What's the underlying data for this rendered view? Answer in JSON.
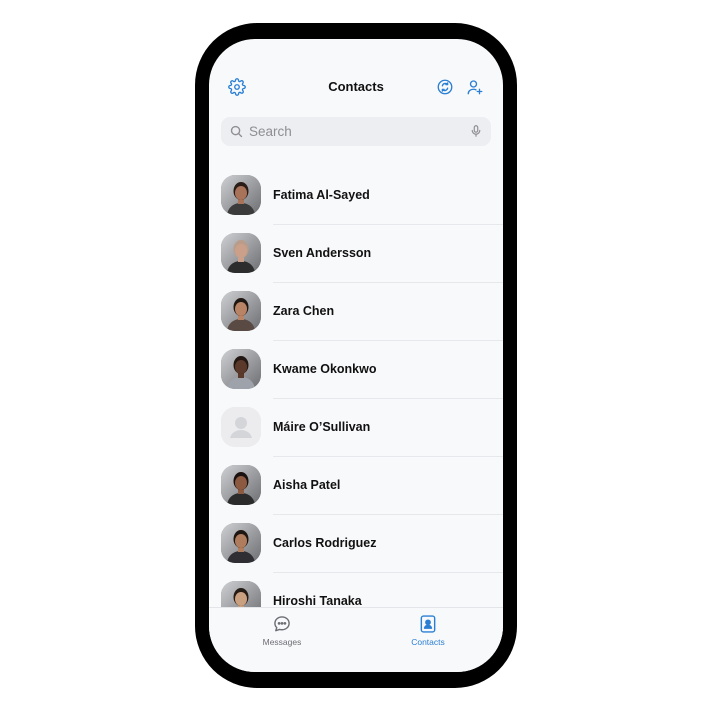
{
  "header": {
    "title": "Contacts",
    "left_icon": "gear-icon",
    "right_icons": [
      "sync-icon",
      "add-contact-icon"
    ]
  },
  "search": {
    "placeholder": "Search",
    "value": "",
    "icon": "search-icon",
    "mic_icon": "microphone-icon"
  },
  "contacts": [
    {
      "name": "Fatima Al-Sayed",
      "avatar": "photo",
      "skin": "#a9735a",
      "hair": "#2a1d18",
      "shirt": "#3b3b3b"
    },
    {
      "name": "Sven Andersson",
      "avatar": "photo",
      "skin": "#caa08b",
      "hair": "#b99d8a",
      "shirt": "#2d2d2d"
    },
    {
      "name": "Zara Chen",
      "avatar": "photo",
      "skin": "#b88465",
      "hair": "#1f1713",
      "shirt": "#5a4a44"
    },
    {
      "name": "Kwame Okonkwo",
      "avatar": "photo",
      "skin": "#5b3a2b",
      "hair": "#221712",
      "shirt": "#9ea3ab"
    },
    {
      "name": "Máire O’Sullivan",
      "avatar": "placeholder"
    },
    {
      "name": "Aisha Patel",
      "avatar": "photo",
      "skin": "#8c5a41",
      "hair": "#1a1210",
      "shirt": "#2b2b2b"
    },
    {
      "name": "Carlos Rodriguez",
      "avatar": "photo",
      "skin": "#b07c5e",
      "hair": "#1e1612",
      "shirt": "#2f2f33"
    },
    {
      "name": "Hiroshi Tanaka",
      "avatar": "photo",
      "skin": "#c9a080",
      "hair": "#261c16",
      "shirt": "#4a4a4a"
    }
  ],
  "tabs": [
    {
      "label": "Messages",
      "icon": "chat-bubble-icon",
      "active": false
    },
    {
      "label": "Contacts",
      "icon": "contacts-book-icon",
      "active": true
    }
  ],
  "colors": {
    "accent": "#2a7fd4",
    "inactive": "#6e6e73",
    "background": "#f8f9fb"
  }
}
